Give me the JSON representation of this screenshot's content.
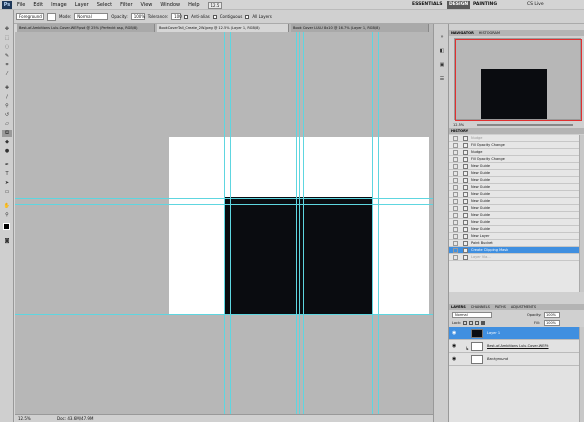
{
  "app": {
    "logo": "Ps"
  },
  "menu": [
    "File",
    "Edit",
    "Image",
    "Layer",
    "Select",
    "Filter",
    "View",
    "Window",
    "Help"
  ],
  "zoom_menu": "12.5",
  "workspaces": {
    "essentials": "ESSENTIALS",
    "design": "DESIGN",
    "painting": "PAINTING",
    "cs_live": "CS Live"
  },
  "options": {
    "fill_source": "Foreground",
    "mode_label": "Mode:",
    "mode_value": "Normal",
    "opacity_label": "Opacity:",
    "opacity_value": "100%",
    "tolerance_label": "Tolerance:",
    "tolerance_value": "100",
    "anti_alias": "Anti-alias",
    "contiguous": "Contiguous",
    "all_layers": "All Layers"
  },
  "tabs": [
    "Best-of-Ambitions Lulu-Cover-WEP.psd @ 25% (Perfeckt asp, RGB/8)",
    "BookCoverTall_Create_2W.jpeg @ 12.5% (Layer 1, RGB/8)",
    "Book Cover LULU 8x10 @ 16.7% (Layer 1, RGB/8)"
  ],
  "navigator": {
    "tabs": [
      "NAVIGATOR",
      "HISTOGRAM"
    ],
    "zoom": "12.5%"
  },
  "history": {
    "tab": "HISTORY",
    "items": [
      "Nudge",
      "Fill Opacity Change",
      "Nudge",
      "Fill Opacity Change",
      "New Guide",
      "New Guide",
      "New Guide",
      "New Guide",
      "New Guide",
      "New Guide",
      "New Guide",
      "New Guide",
      "New Guide",
      "New Guide",
      "New Layer",
      "Paint Bucket",
      "Create Clipping Mask",
      "Layer Via..."
    ]
  },
  "layers": {
    "tabs": [
      "LAYERS",
      "CHANNELS",
      "PATHS",
      "ADJUSTMENTS"
    ],
    "blend_mode": "Normal",
    "opacity_label": "Opacity:",
    "opacity": "100%",
    "lock_label": "Lock:",
    "fill_label": "Fill:",
    "fill": "100%",
    "items": [
      {
        "name": "Layer 1"
      },
      {
        "name": "Best-of-Ambitions Lulu-Cover-WEP.t"
      },
      {
        "name": "Background"
      }
    ]
  },
  "status": {
    "zoom": "12.5%",
    "doc": "Doc: 43.6M/47.9M"
  },
  "colors": {
    "accent": "#3f8fe0",
    "guide": "#5ed6e0",
    "canvas_bg": "#b7b7b7",
    "shape": "#0a0c10"
  }
}
